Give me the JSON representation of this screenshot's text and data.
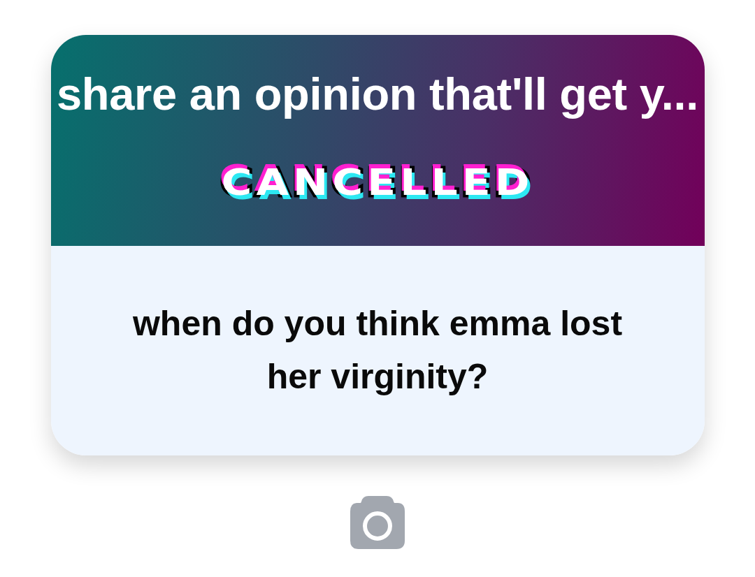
{
  "card": {
    "title": "share an opinion that'll get y...",
    "sticker": {
      "text": "CANCELLED"
    },
    "question": "when do you think emma lost her virginity?"
  }
}
